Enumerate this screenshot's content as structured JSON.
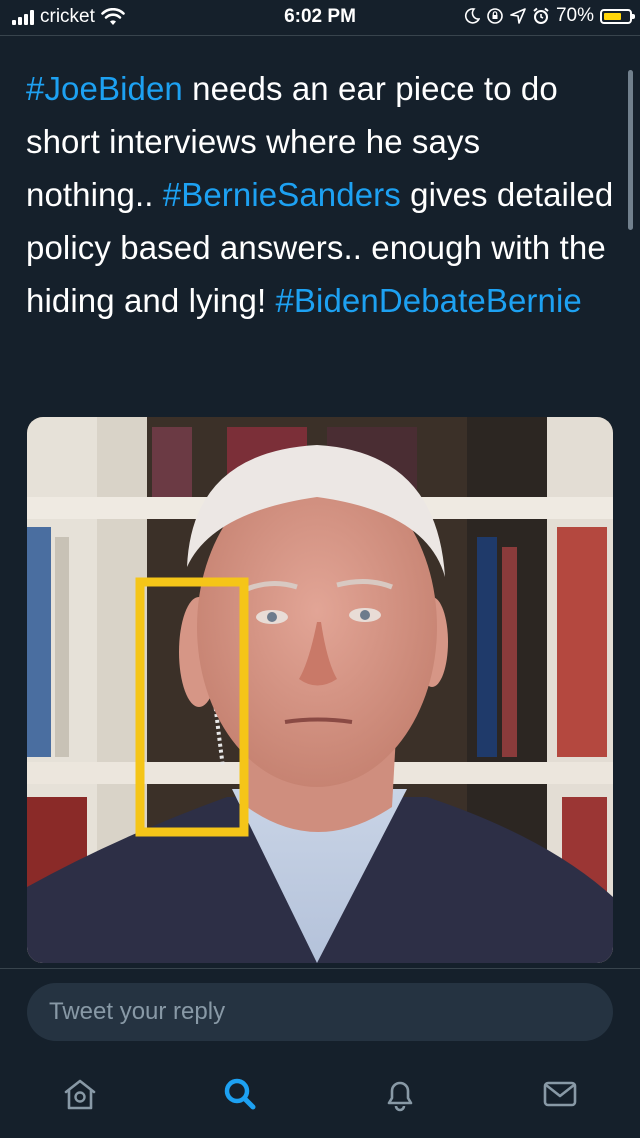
{
  "status_bar": {
    "carrier": "cricket",
    "time": "6:02 PM",
    "battery": "70%",
    "battery_level": 0.7,
    "icons": [
      "signal-icon",
      "wifi-icon",
      "moon-icon",
      "orientation-lock-icon",
      "location-icon",
      "alarm-icon",
      "battery-icon"
    ]
  },
  "tweet": {
    "hashtag_1": "#JoeBiden",
    "text_1": " needs an ear piece to do short interviews where he says nothing.. ",
    "hashtag_2": "#BernieSanders",
    "text_2": " gives detailed policy based answers.. enough with the hiding and lying! ",
    "hashtag_3": "#BidenDebateBernie"
  },
  "reply": {
    "placeholder": "Tweet your reply"
  },
  "tab_bar": {
    "tabs": [
      "home-icon",
      "search-icon",
      "notifications-icon",
      "messages-icon"
    ],
    "active": "search-icon"
  },
  "colors": {
    "background": "#15202b",
    "accent": "#1da1f2",
    "highlight_box": "#f5c518"
  }
}
